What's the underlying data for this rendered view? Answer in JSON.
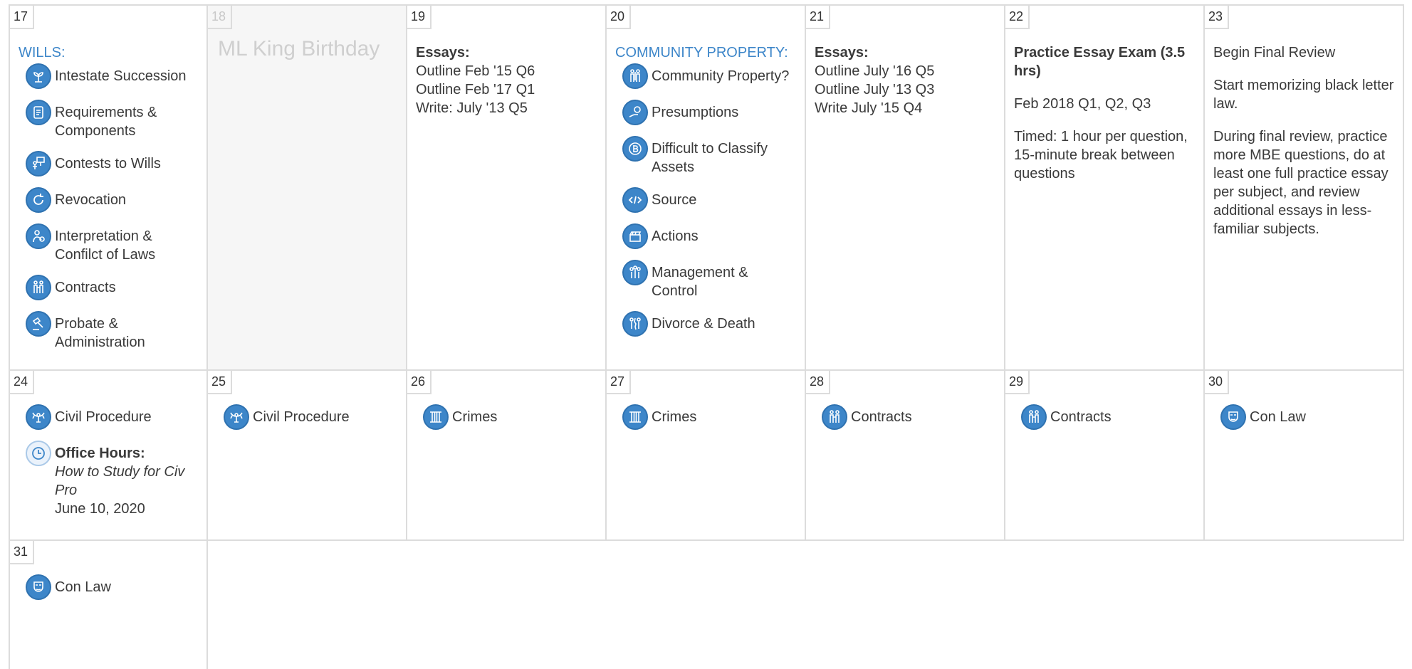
{
  "week1": {
    "d17": {
      "day": "17",
      "title": "WILLS:",
      "items": [
        {
          "label": "Intestate Succession",
          "icon": "sprout-icon"
        },
        {
          "label": "Requirements & Components",
          "icon": "scroll-icon"
        },
        {
          "label": "Contests to Wills",
          "icon": "protest-sign-icon"
        },
        {
          "label": "Revocation",
          "icon": "circular-arrow-icon"
        },
        {
          "label": "Interpretation & Confilct of Laws",
          "icon": "person-thinking-icon"
        },
        {
          "label": "Contracts",
          "icon": "handshake-people-icon"
        },
        {
          "label": "Probate & Administration",
          "icon": "gavel-icon"
        }
      ]
    },
    "d18": {
      "day": "18",
      "holiday": "ML King Birthday"
    },
    "d19": {
      "day": "19",
      "heading": "Essays:",
      "lines": [
        "Outline Feb '15 Q6",
        "Outline Feb '17 Q1",
        "Write: July '13 Q5"
      ]
    },
    "d20": {
      "day": "20",
      "title": "COMMUNITY PROPERTY:",
      "items": [
        {
          "label": "Community Property?",
          "icon": "couple-icon"
        },
        {
          "label": "Presumptions",
          "icon": "coin-hand-icon"
        },
        {
          "label": "Difficult to Classify Assets",
          "icon": "bitcoin-icon"
        },
        {
          "label": "Source",
          "icon": "code-brackets-icon"
        },
        {
          "label": "Actions",
          "icon": "clapperboard-icon"
        },
        {
          "label": "Management & Control",
          "icon": "people-group-icon"
        },
        {
          "label": "Divorce & Death",
          "icon": "split-couple-icon"
        }
      ]
    },
    "d21": {
      "day": "21",
      "heading": "Essays:",
      "lines": [
        "Outline July '16 Q5",
        "Outline July '13 Q3",
        "Write July '15 Q4"
      ]
    },
    "d22": {
      "day": "22",
      "heading": "Practice Essay Exam (3.5 hrs)",
      "para1": "Feb 2018 Q1, Q2, Q3",
      "para2a": "Timed: 1 hour per question,",
      "para2b": "15-minute break between questions"
    },
    "d23": {
      "day": "23",
      "para1": "Begin Final Review",
      "para2": "Start memorizing black letter law.",
      "para3": "During final review, practice more MBE questions, do at least one full practice essay per subject, and review additional essays in less-familiar subjects."
    }
  },
  "week2": {
    "d24": {
      "day": "24",
      "item": {
        "label": "Civil Procedure",
        "icon": "eagle-seal-icon"
      },
      "office": {
        "heading": "Office Hours:",
        "title": "How to Study for Civ Pro",
        "date": "June 10, 2020",
        "icon": "clock-icon"
      }
    },
    "d25": {
      "day": "25",
      "item": {
        "label": "Civil Procedure",
        "icon": "eagle-seal-icon"
      }
    },
    "d26": {
      "day": "26",
      "item": {
        "label": "Crimes",
        "icon": "jail-bars-icon"
      }
    },
    "d27": {
      "day": "27",
      "item": {
        "label": "Crimes",
        "icon": "jail-bars-icon"
      }
    },
    "d28": {
      "day": "28",
      "item": {
        "label": "Contracts",
        "icon": "handshake-people-icon"
      }
    },
    "d29": {
      "day": "29",
      "item": {
        "label": "Contracts",
        "icon": "handshake-people-icon"
      }
    },
    "d30": {
      "day": "30",
      "item": {
        "label": "Con Law",
        "icon": "mask-icon"
      }
    }
  },
  "week3": {
    "d31": {
      "day": "31",
      "item": {
        "label": "Con Law",
        "icon": "mask-icon"
      }
    }
  },
  "colors": {
    "accent": "#3d86c9",
    "border": "#dcdcdc",
    "muted_bg": "#f6f6f6",
    "text": "#3a3a3a"
  }
}
